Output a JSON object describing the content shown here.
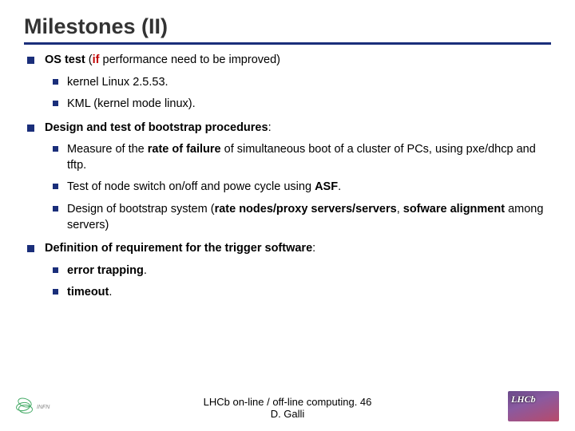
{
  "title": "Milestones (II)",
  "sec1": {
    "lead_b": "OS test",
    "lead_after": " (",
    "lead_red": "if",
    "lead_tail": " performance need to be improved)",
    "i1": "kernel Linux 2.5.53.",
    "i2": "KML (kernel mode linux)."
  },
  "sec2": {
    "heading": "Design and test of bootstrap procedures",
    "colon": ":",
    "i1a": "Measure of the ",
    "i1b": "rate of failure",
    "i1c": " of simultaneous boot of a cluster of PCs, using pxe/dhcp and tftp.",
    "i2a": "Test of node switch on/off and powe cycle using ",
    "i2b": "ASF",
    "i2c": ".",
    "i3a": "Design of bootstrap system (",
    "i3b": "rate nodes/proxy servers/servers",
    "i3c": ", ",
    "i3d": "sofware alignment",
    "i3e": " among servers)"
  },
  "sec3": {
    "heading": "Definition of requirement for the trigger software",
    "colon": ":",
    "i1": "error trapping",
    "i1dot": ".",
    "i2": "timeout",
    "i2dot": "."
  },
  "footer": {
    "line1": "LHCb on-line / off-line computing. 46",
    "line2": "D. Galli"
  },
  "logos": {
    "left": "INFN",
    "right": "LHCb"
  }
}
